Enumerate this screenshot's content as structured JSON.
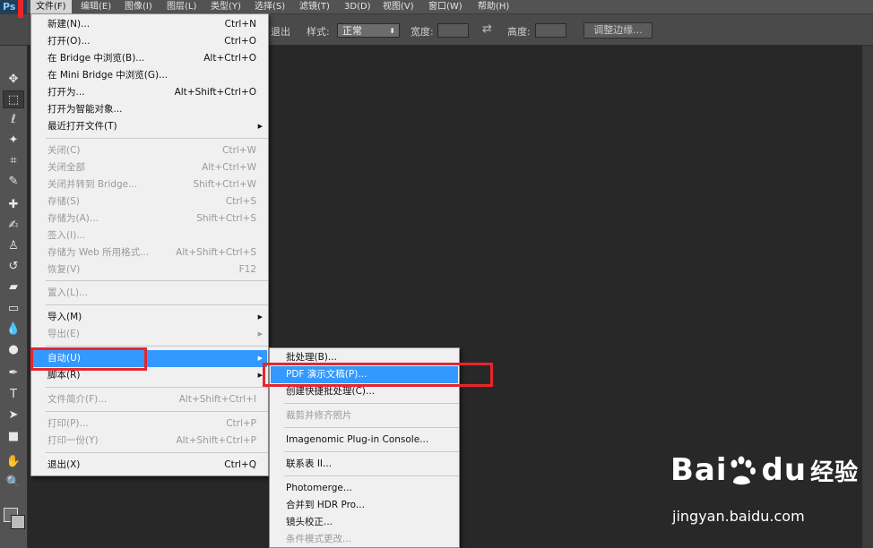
{
  "app": {
    "logo": "Ps"
  },
  "menubar": {
    "items": [
      "文件(F)",
      "编辑(E)",
      "图像(I)",
      "图层(L)",
      "类型(Y)",
      "选择(S)",
      "滤镜(T)",
      "3D(D)",
      "视图(V)",
      "窗口(W)",
      "帮助(H)"
    ]
  },
  "options": {
    "partial_label": "退出",
    "style_label": "样式:",
    "style_value": "正常",
    "width_label": "宽度:",
    "height_label": "高度:",
    "refine_button": "调整边缘..."
  },
  "file_menu": {
    "items": [
      {
        "label": "新建(N)...",
        "shortcut": "Ctrl+N"
      },
      {
        "label": "打开(O)...",
        "shortcut": "Ctrl+O"
      },
      {
        "label": "在 Bridge 中浏览(B)...",
        "shortcut": "Alt+Ctrl+O"
      },
      {
        "label": "在 Mini Bridge 中浏览(G)...",
        "shortcut": ""
      },
      {
        "label": "打开为...",
        "shortcut": "Alt+Shift+Ctrl+O"
      },
      {
        "label": "打开为智能对象...",
        "shortcut": ""
      },
      {
        "label": "最近打开文件(T)",
        "shortcut": ""
      },
      {
        "label": "关闭(C)",
        "shortcut": "Ctrl+W"
      },
      {
        "label": "关闭全部",
        "shortcut": "Alt+Ctrl+W"
      },
      {
        "label": "关闭并转到 Bridge...",
        "shortcut": "Shift+Ctrl+W"
      },
      {
        "label": "存储(S)",
        "shortcut": "Ctrl+S"
      },
      {
        "label": "存储为(A)...",
        "shortcut": "Shift+Ctrl+S"
      },
      {
        "label": "签入(I)...",
        "shortcut": ""
      },
      {
        "label": "存储为 Web 所用格式...",
        "shortcut": "Alt+Shift+Ctrl+S"
      },
      {
        "label": "恢复(V)",
        "shortcut": "F12"
      },
      {
        "label": "置入(L)...",
        "shortcut": ""
      },
      {
        "label": "导入(M)",
        "shortcut": ""
      },
      {
        "label": "导出(E)",
        "shortcut": ""
      },
      {
        "label": "自动(U)",
        "shortcut": ""
      },
      {
        "label": "脚本(R)",
        "shortcut": ""
      },
      {
        "label": "文件简介(F)...",
        "shortcut": "Alt+Shift+Ctrl+I"
      },
      {
        "label": "打印(P)...",
        "shortcut": "Ctrl+P"
      },
      {
        "label": "打印一份(Y)",
        "shortcut": "Alt+Shift+Ctrl+P"
      },
      {
        "label": "退出(X)",
        "shortcut": "Ctrl+Q"
      }
    ]
  },
  "automate_submenu": {
    "items": [
      {
        "label": "批处理(B)..."
      },
      {
        "label": "PDF 演示文稿(P)..."
      },
      {
        "label": "创建快捷批处理(C)..."
      },
      {
        "label": "裁剪并修齐照片"
      },
      {
        "label": "Imagenomic Plug-in Console..."
      },
      {
        "label": "联系表 II..."
      },
      {
        "label": "Photomerge..."
      },
      {
        "label": "合并到 HDR Pro..."
      },
      {
        "label": "镜头校正..."
      },
      {
        "label": "条件模式更改..."
      }
    ]
  },
  "watermark": {
    "logo_text": "Bai",
    "logo_suffix": "du",
    "logo_cn": "经验",
    "url": "jingyan.baidu.com"
  },
  "colors": {
    "highlight": "#3399ff",
    "annotation": "#e8262a"
  }
}
